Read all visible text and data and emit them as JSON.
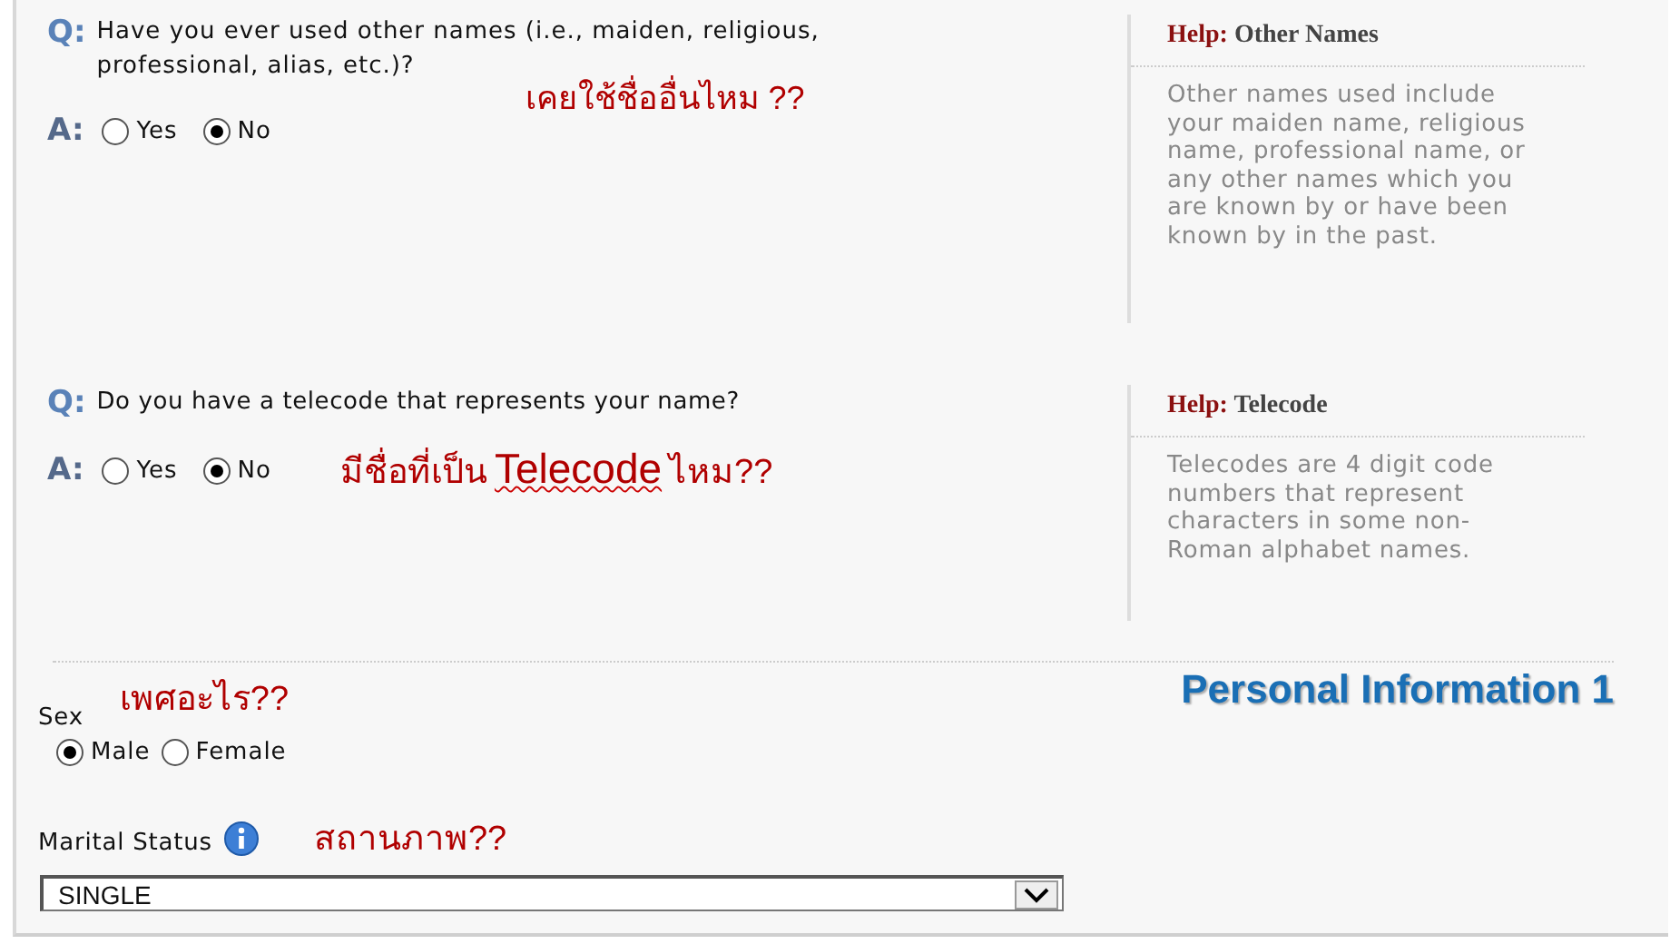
{
  "questions": [
    {
      "q_label": "Q:",
      "question": "Have you ever used other names (i.e., maiden, religious, professional, alias, etc.)?",
      "annotation": [
        {
          "text": "เคยใช้ชื่ออื่นไหม ??",
          "flagged": false
        }
      ],
      "a_label": "A:",
      "options": [
        {
          "label": "Yes",
          "selected": false
        },
        {
          "label": "No",
          "selected": true
        }
      ],
      "help": {
        "label": "Help:",
        "title": "Other Names",
        "text": "Other names used include your maiden name, religious name, professional name, or any other names which you are known by or have been known by in the past."
      }
    },
    {
      "q_label": "Q:",
      "question": "Do you have a telecode that represents your name?",
      "annotation": [
        {
          "text": "มีชื่อที่เป็น",
          "flagged": false
        },
        {
          "text": "Telecode",
          "flagged": true
        },
        {
          "text": "ไหม??",
          "flagged": false
        }
      ],
      "a_label": "A:",
      "options": [
        {
          "label": "Yes",
          "selected": false
        },
        {
          "label": "No",
          "selected": true
        }
      ],
      "help": {
        "label": "Help:",
        "title": "Telecode",
        "text": "Telecodes are 4 digit code numbers that represent characters in some non-Roman alphabet names."
      }
    }
  ],
  "sex": {
    "label": "Sex",
    "annotation": "เพศอะไร??",
    "options": [
      {
        "label": "Male",
        "selected": true
      },
      {
        "label": "Female",
        "selected": false
      }
    ]
  },
  "section_title": "Personal Information 1",
  "marital_status": {
    "label": "Marital Status",
    "annotation": "สถานภาพ??",
    "value": "SINGLE"
  }
}
